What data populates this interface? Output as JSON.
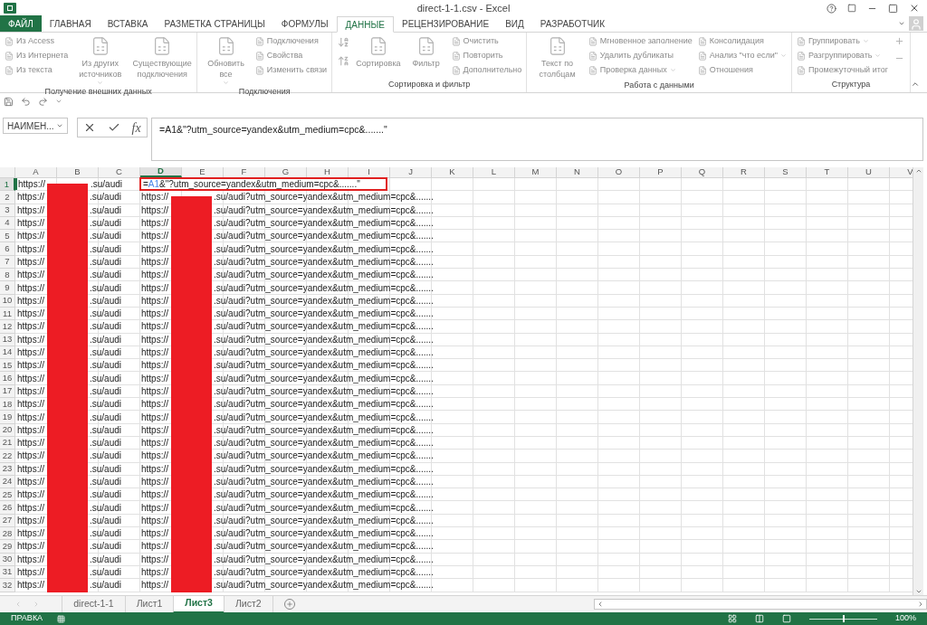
{
  "window": {
    "title": "direct-1-1.csv - Excel"
  },
  "ribbon_tabs": [
    {
      "label": "ФАЙЛ",
      "kind": "file",
      "selected": false
    },
    {
      "label": "ГЛАВНАЯ",
      "kind": "tab",
      "selected": false
    },
    {
      "label": "ВСТАВКА",
      "kind": "tab",
      "selected": false
    },
    {
      "label": "РАЗМЕТКА СТРАНИЦЫ",
      "kind": "tab",
      "selected": false
    },
    {
      "label": "ФОРМУЛЫ",
      "kind": "tab",
      "selected": false
    },
    {
      "label": "ДАННЫЕ",
      "kind": "tab",
      "selected": true
    },
    {
      "label": "РЕЦЕНЗИРОВАНИЕ",
      "kind": "tab",
      "selected": false
    },
    {
      "label": "ВИД",
      "kind": "tab",
      "selected": false
    },
    {
      "label": "РАЗРАБОТЧИК",
      "kind": "tab",
      "selected": false
    }
  ],
  "ribbon_disabled": true,
  "ribbon_groups": [
    {
      "name": "Получение внешних данных",
      "columns": [
        {
          "kind": "small",
          "items": [
            {
              "label": "Из Access",
              "dropdown": false
            },
            {
              "label": "Из Интернета",
              "dropdown": false
            },
            {
              "label": "Из текста",
              "dropdown": false
            }
          ]
        },
        {
          "kind": "large",
          "items": [
            {
              "label": "Из других источников",
              "dropdown": true
            }
          ]
        },
        {
          "kind": "large",
          "items": [
            {
              "label": "Существующие подключения",
              "dropdown": false
            }
          ]
        }
      ]
    },
    {
      "name": "Подключения",
      "columns": [
        {
          "kind": "large",
          "items": [
            {
              "label": "Обновить все",
              "dropdown": true
            }
          ]
        },
        {
          "kind": "small",
          "items": [
            {
              "label": "Подключения",
              "dropdown": false
            },
            {
              "label": "Свойства",
              "dropdown": false
            },
            {
              "label": "Изменить связи",
              "dropdown": false
            }
          ]
        }
      ]
    },
    {
      "name": "Сортировка и фильтр",
      "columns": [
        {
          "kind": "sort_icons"
        },
        {
          "kind": "large",
          "items": [
            {
              "label": "Сортировка",
              "dropdown": false
            }
          ]
        },
        {
          "kind": "large",
          "items": [
            {
              "label": "Фильтр",
              "dropdown": false
            }
          ]
        },
        {
          "kind": "small",
          "items": [
            {
              "label": "Очистить",
              "dropdown": false
            },
            {
              "label": "Повторить",
              "dropdown": false
            },
            {
              "label": "Дополнительно",
              "dropdown": false
            }
          ]
        }
      ]
    },
    {
      "name": "Работа с данными",
      "columns": [
        {
          "kind": "large",
          "items": [
            {
              "label": "Текст по столбцам",
              "dropdown": false
            }
          ]
        },
        {
          "kind": "small",
          "items": [
            {
              "label": "Мгновенное заполнение",
              "dropdown": false
            },
            {
              "label": "Удалить дубликаты",
              "dropdown": false
            },
            {
              "label": "Проверка данных",
              "dropdown": true
            }
          ]
        },
        {
          "kind": "small",
          "items": [
            {
              "label": "Консолидация",
              "dropdown": false
            },
            {
              "label": "Анализ \"что если\"",
              "dropdown": true
            },
            {
              "label": "Отношения",
              "dropdown": false
            }
          ]
        }
      ]
    },
    {
      "name": "Структура",
      "columns": [
        {
          "kind": "small",
          "items": [
            {
              "label": "Группировать",
              "dropdown": true
            },
            {
              "label": "Разгруппировать",
              "dropdown": true
            },
            {
              "label": "Промежуточный итог",
              "dropdown": false
            }
          ]
        },
        {
          "kind": "outline_icons"
        }
      ]
    }
  ],
  "name_box": "НАИМЕН...",
  "function_button": "fx",
  "formula": "=A1&\"?utm_source=yandex&utm_medium=cpc&.......\"",
  "columns": [
    {
      "label": "A",
      "selected": false
    },
    {
      "label": "B",
      "selected": false
    },
    {
      "label": "C",
      "selected": false
    },
    {
      "label": "D",
      "selected": true
    },
    {
      "label": "E",
      "selected": false
    },
    {
      "label": "F",
      "selected": false
    },
    {
      "label": "G",
      "selected": false
    },
    {
      "label": "H",
      "selected": false
    },
    {
      "label": "I",
      "selected": false
    },
    {
      "label": "J",
      "selected": false
    },
    {
      "label": "K",
      "selected": false
    },
    {
      "label": "L",
      "selected": false
    },
    {
      "label": "M",
      "selected": false
    },
    {
      "label": "N",
      "selected": false
    },
    {
      "label": "O",
      "selected": false
    },
    {
      "label": "P",
      "selected": false
    },
    {
      "label": "Q",
      "selected": false
    },
    {
      "label": "R",
      "selected": false
    },
    {
      "label": "S",
      "selected": false
    },
    {
      "label": "T",
      "selected": false
    },
    {
      "label": "U",
      "selected": false
    },
    {
      "label": "V",
      "selected": false
    }
  ],
  "active_cell": {
    "row": "1",
    "a_prefix": "https://",
    "a_suffix": ".su/audi",
    "eq": "=",
    "ref": "A1",
    "rest": "&\"?utm_source=yandex&utm_medium=cpc&.......\""
  },
  "rows": [
    {
      "row": "2",
      "a_prefix": "https://",
      "a_suffix": ".su/audi",
      "d_prefix": "https://",
      "d_suffix": ".su/audi?utm_source=yandex&utm_medium=cpc&......."
    },
    {
      "row": "3",
      "a_prefix": "https://",
      "a_suffix": ".su/audi",
      "d_prefix": "https://",
      "d_suffix": ".su/audi?utm_source=yandex&utm_medium=cpc&......."
    },
    {
      "row": "4",
      "a_prefix": "https://",
      "a_suffix": ".su/audi",
      "d_prefix": "https://",
      "d_suffix": ".su/audi?utm_source=yandex&utm_medium=cpc&......."
    },
    {
      "row": "5",
      "a_prefix": "https://",
      "a_suffix": ".su/audi",
      "d_prefix": "https://",
      "d_suffix": ".su/audi?utm_source=yandex&utm_medium=cpc&......."
    },
    {
      "row": "6",
      "a_prefix": "https://",
      "a_suffix": ".su/audi",
      "d_prefix": "https://",
      "d_suffix": ".su/audi?utm_source=yandex&utm_medium=cpc&......."
    },
    {
      "row": "7",
      "a_prefix": "https://",
      "a_suffix": ".su/audi",
      "d_prefix": "https://",
      "d_suffix": ".su/audi?utm_source=yandex&utm_medium=cpc&......."
    },
    {
      "row": "8",
      "a_prefix": "https://",
      "a_suffix": ".su/audi",
      "d_prefix": "https://",
      "d_suffix": ".su/audi?utm_source=yandex&utm_medium=cpc&......."
    },
    {
      "row": "9",
      "a_prefix": "https://",
      "a_suffix": ".su/audi",
      "d_prefix": "https://",
      "d_suffix": ".su/audi?utm_source=yandex&utm_medium=cpc&......."
    },
    {
      "row": "10",
      "a_prefix": "https://",
      "a_suffix": ".su/audi",
      "d_prefix": "https://",
      "d_suffix": ".su/audi?utm_source=yandex&utm_medium=cpc&......."
    },
    {
      "row": "11",
      "a_prefix": "https://",
      "a_suffix": ".su/audi",
      "d_prefix": "https://",
      "d_suffix": ".su/audi?utm_source=yandex&utm_medium=cpc&......."
    },
    {
      "row": "12",
      "a_prefix": "https://",
      "a_suffix": ".su/audi",
      "d_prefix": "https://",
      "d_suffix": ".su/audi?utm_source=yandex&utm_medium=cpc&......."
    },
    {
      "row": "13",
      "a_prefix": "https://",
      "a_suffix": ".su/audi",
      "d_prefix": "https://",
      "d_suffix": ".su/audi?utm_source=yandex&utm_medium=cpc&......."
    },
    {
      "row": "14",
      "a_prefix": "https://",
      "a_suffix": ".su/audi",
      "d_prefix": "https://",
      "d_suffix": ".su/audi?utm_source=yandex&utm_medium=cpc&......."
    },
    {
      "row": "15",
      "a_prefix": "https://",
      "a_suffix": ".su/audi",
      "d_prefix": "https://",
      "d_suffix": ".su/audi?utm_source=yandex&utm_medium=cpc&......."
    },
    {
      "row": "16",
      "a_prefix": "https://",
      "a_suffix": ".su/audi",
      "d_prefix": "https://",
      "d_suffix": ".su/audi?utm_source=yandex&utm_medium=cpc&......."
    },
    {
      "row": "17",
      "a_prefix": "https://",
      "a_suffix": ".su/audi",
      "d_prefix": "https://",
      "d_suffix": ".su/audi?utm_source=yandex&utm_medium=cpc&......."
    },
    {
      "row": "18",
      "a_prefix": "https://",
      "a_suffix": ".su/audi",
      "d_prefix": "https://",
      "d_suffix": ".su/audi?utm_source=yandex&utm_medium=cpc&......."
    },
    {
      "row": "19",
      "a_prefix": "https://",
      "a_suffix": ".su/audi",
      "d_prefix": "https://",
      "d_suffix": ".su/audi?utm_source=yandex&utm_medium=cpc&......."
    },
    {
      "row": "20",
      "a_prefix": "https://",
      "a_suffix": ".su/audi",
      "d_prefix": "https://",
      "d_suffix": ".su/audi?utm_source=yandex&utm_medium=cpc&......."
    },
    {
      "row": "21",
      "a_prefix": "https://",
      "a_suffix": ".su/audi",
      "d_prefix": "https://",
      "d_suffix": ".su/audi?utm_source=yandex&utm_medium=cpc&......."
    },
    {
      "row": "22",
      "a_prefix": "https://",
      "a_suffix": ".su/audi",
      "d_prefix": "https://",
      "d_suffix": ".su/audi?utm_source=yandex&utm_medium=cpc&......."
    },
    {
      "row": "23",
      "a_prefix": "https://",
      "a_suffix": ".su/audi",
      "d_prefix": "https://",
      "d_suffix": ".su/audi?utm_source=yandex&utm_medium=cpc&......."
    },
    {
      "row": "24",
      "a_prefix": "https://",
      "a_suffix": ".su/audi",
      "d_prefix": "https://",
      "d_suffix": ".su/audi?utm_source=yandex&utm_medium=cpc&......."
    },
    {
      "row": "25",
      "a_prefix": "https://",
      "a_suffix": ".su/audi",
      "d_prefix": "https://",
      "d_suffix": ".su/audi?utm_source=yandex&utm_medium=cpc&......."
    },
    {
      "row": "26",
      "a_prefix": "https://",
      "a_suffix": ".su/audi",
      "d_prefix": "https://",
      "d_suffix": ".su/audi?utm_source=yandex&utm_medium=cpc&......."
    },
    {
      "row": "27",
      "a_prefix": "https://",
      "a_suffix": ".su/audi",
      "d_prefix": "https://",
      "d_suffix": ".su/audi?utm_source=yandex&utm_medium=cpc&......."
    },
    {
      "row": "28",
      "a_prefix": "https://",
      "a_suffix": ".su/audi",
      "d_prefix": "https://",
      "d_suffix": ".su/audi?utm_source=yandex&utm_medium=cpc&......."
    },
    {
      "row": "29",
      "a_prefix": "https://",
      "a_suffix": ".su/audi",
      "d_prefix": "https://",
      "d_suffix": ".su/audi?utm_source=yandex&utm_medium=cpc&......."
    },
    {
      "row": "30",
      "a_prefix": "https://",
      "a_suffix": ".su/audi",
      "d_prefix": "https://",
      "d_suffix": ".su/audi?utm_source=yandex&utm_medium=cpc&......."
    },
    {
      "row": "31",
      "a_prefix": "https://",
      "a_suffix": ".su/audi",
      "d_prefix": "https://",
      "d_suffix": ".su/audi?utm_source=yandex&utm_medium=cpc&......."
    },
    {
      "row": "32",
      "a_prefix": "https://",
      "a_suffix": ".su/audi",
      "d_prefix": "https://",
      "d_suffix": ".su/audi?utm_source=yandex&utm_medium=cpc&......."
    }
  ],
  "sheet_tabs": [
    {
      "label": "direct-1-1",
      "selected": false
    },
    {
      "label": "Лист1",
      "selected": false
    },
    {
      "label": "Лист3",
      "selected": true
    },
    {
      "label": "Лист2",
      "selected": false
    }
  ],
  "status_bar": {
    "mode": "ПРАВКА",
    "zoom": "100%",
    "zoom_slider": {
      "level": 0.5
    }
  }
}
